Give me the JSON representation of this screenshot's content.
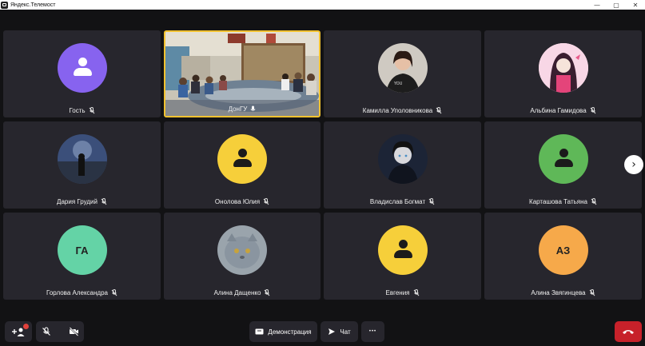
{
  "window": {
    "title": "Яндекс.Телемост",
    "minimize_glyph": "—",
    "maximize_glyph": "▢",
    "close_glyph": "✕"
  },
  "participants": [
    {
      "name": "Гость",
      "avatar": "person-icon",
      "color": "#8763ef",
      "fg": "#ffffff"
    },
    {
      "name": "ДонГУ",
      "avatar": "video-feed",
      "active": true
    },
    {
      "name": "Камилла Уполовникова",
      "avatar": "photo"
    },
    {
      "name": "Альбина Гамидова",
      "avatar": "photo"
    },
    {
      "name": "Дария Грудий",
      "avatar": "photo"
    },
    {
      "name": "Онолова Юлия",
      "avatar": "person-icon",
      "color": "#f6cf3a",
      "fg": "#1b1b1b"
    },
    {
      "name": "Владислав Богмат",
      "avatar": "photo"
    },
    {
      "name": "Карташова Татьяна",
      "avatar": "person-icon",
      "color": "#5fb858",
      "fg": "#1b1b1b"
    },
    {
      "name": "Горлова Александра",
      "avatar": "initials",
      "initials": "ГА",
      "color": "#64d3a6"
    },
    {
      "name": "Алина Дащенко",
      "avatar": "photo"
    },
    {
      "name": "Евгения",
      "avatar": "person-icon",
      "color": "#f6cf3a",
      "fg": "#1b1b1b"
    },
    {
      "name": "Алина Звягинцева",
      "avatar": "initials",
      "initials": "АЗ",
      "color": "#f6a94a"
    }
  ],
  "toolbar": {
    "screen_share_label": "Демонстрация",
    "chat_label": "Чат",
    "more_glyph": "•••"
  },
  "colors": {
    "background": "#121214",
    "tile": "#27262d",
    "active_border": "#f2c230",
    "hangup": "#c7212a"
  }
}
